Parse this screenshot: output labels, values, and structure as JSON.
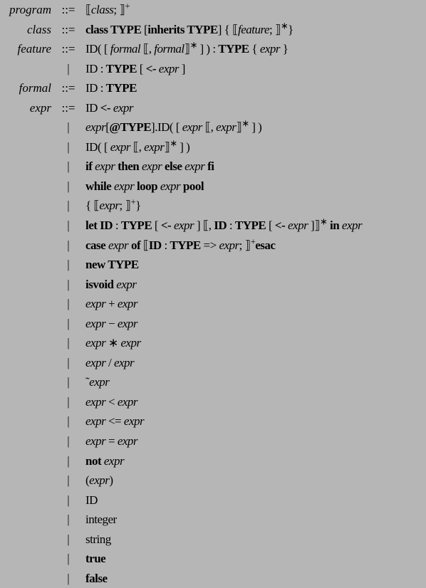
{
  "rows": [
    {
      "lhs": "program",
      "op": "::=",
      "rhs": [
        {
          "t": "⟦",
          "c": ""
        },
        {
          "t": "class",
          "c": "it"
        },
        {
          "t": "; ⟧",
          "c": ""
        },
        {
          "t": "+",
          "c": "sup"
        }
      ]
    },
    {
      "lhs": "class",
      "op": "::=",
      "rhs": [
        {
          "t": "class TYPE ",
          "c": "bf"
        },
        {
          "t": "[",
          "c": ""
        },
        {
          "t": "inherits TYPE",
          "c": "bf"
        },
        {
          "t": "]",
          "c": ""
        },
        {
          "t": " { ⟦",
          "c": ""
        },
        {
          "t": "feature",
          "c": "it"
        },
        {
          "t": "; ⟧",
          "c": ""
        },
        {
          "t": "∗",
          "c": "sup"
        },
        {
          "t": "}",
          "c": ""
        }
      ]
    },
    {
      "lhs": "feature",
      "op": "::=",
      "rhs": [
        {
          "t": "ID",
          "c": ""
        },
        {
          "t": "( [ ",
          "c": ""
        },
        {
          "t": "formal",
          "c": "it"
        },
        {
          "t": " ⟦, ",
          "c": ""
        },
        {
          "t": "formal",
          "c": "it"
        },
        {
          "t": "⟧",
          "c": ""
        },
        {
          "t": "∗",
          "c": "sup"
        },
        {
          "t": " ] ) : ",
          "c": ""
        },
        {
          "t": "TYPE",
          "c": "bf"
        },
        {
          "t": " { ",
          "c": ""
        },
        {
          "t": "expr",
          "c": "it"
        },
        {
          "t": " }",
          "c": ""
        }
      ]
    },
    {
      "lhs": "",
      "op": "|",
      "rhs": [
        {
          "t": "ID : ",
          "c": ""
        },
        {
          "t": "TYPE",
          "c": "bf"
        },
        {
          "t": " [ ",
          "c": ""
        },
        {
          "t": "<- ",
          "c": "bf"
        },
        {
          "t": "expr",
          "c": "it"
        },
        {
          "t": " ]",
          "c": ""
        }
      ]
    },
    {
      "lhs": "formal",
      "op": "::=",
      "rhs": [
        {
          "t": "ID : ",
          "c": ""
        },
        {
          "t": "TYPE",
          "c": "bf"
        }
      ]
    },
    {
      "lhs": "expr",
      "op": "::=",
      "rhs": [
        {
          "t": "ID ",
          "c": ""
        },
        {
          "t": "<- ",
          "c": "bf"
        },
        {
          "t": "expr",
          "c": "it"
        }
      ]
    },
    {
      "lhs": "",
      "op": "|",
      "rhs": [
        {
          "t": "expr",
          "c": "it"
        },
        {
          "t": "[",
          "c": ""
        },
        {
          "t": "@TYPE",
          "c": "bf"
        },
        {
          "t": "].ID( [ ",
          "c": ""
        },
        {
          "t": "expr",
          "c": "it"
        },
        {
          "t": " ⟦, ",
          "c": ""
        },
        {
          "t": "expr",
          "c": "it"
        },
        {
          "t": "⟧",
          "c": ""
        },
        {
          "t": "∗",
          "c": "sup"
        },
        {
          "t": " ] )",
          "c": ""
        }
      ]
    },
    {
      "lhs": "",
      "op": "|",
      "rhs": [
        {
          "t": "ID( [ ",
          "c": ""
        },
        {
          "t": "expr",
          "c": "it"
        },
        {
          "t": " ⟦, ",
          "c": ""
        },
        {
          "t": "expr",
          "c": "it"
        },
        {
          "t": "⟧",
          "c": ""
        },
        {
          "t": "∗",
          "c": "sup"
        },
        {
          "t": " ] )",
          "c": ""
        }
      ]
    },
    {
      "lhs": "",
      "op": "|",
      "rhs": [
        {
          "t": "if ",
          "c": "bf"
        },
        {
          "t": "expr",
          "c": "it"
        },
        {
          "t": " then ",
          "c": "bf"
        },
        {
          "t": "expr",
          "c": "it"
        },
        {
          "t": " else ",
          "c": "bf"
        },
        {
          "t": "expr",
          "c": "it"
        },
        {
          "t": " fi",
          "c": "bf"
        }
      ]
    },
    {
      "lhs": "",
      "op": "|",
      "rhs": [
        {
          "t": "while ",
          "c": "bf"
        },
        {
          "t": "expr",
          "c": "it"
        },
        {
          "t": " loop ",
          "c": "bf"
        },
        {
          "t": "expr",
          "c": "it"
        },
        {
          "t": " pool",
          "c": "bf"
        }
      ]
    },
    {
      "lhs": "",
      "op": "|",
      "rhs": [
        {
          "t": "{ ⟦",
          "c": ""
        },
        {
          "t": "expr",
          "c": "it"
        },
        {
          "t": "; ⟧",
          "c": ""
        },
        {
          "t": "+",
          "c": "sup"
        },
        {
          "t": "}",
          "c": ""
        }
      ]
    },
    {
      "lhs": "",
      "op": "|",
      "rhs": [
        {
          "t": "let ID ",
          "c": "bf"
        },
        {
          "t": ": ",
          "c": ""
        },
        {
          "t": "TYPE",
          "c": "bf"
        },
        {
          "t": " [ ",
          "c": ""
        },
        {
          "t": "<- ",
          "c": "bf"
        },
        {
          "t": "expr",
          "c": "it"
        },
        {
          "t": " ] ⟦, ",
          "c": ""
        },
        {
          "t": "ID ",
          "c": "bf"
        },
        {
          "t": ": ",
          "c": ""
        },
        {
          "t": "TYPE",
          "c": "bf"
        },
        {
          "t": " [ ",
          "c": ""
        },
        {
          "t": "<- ",
          "c": "bf"
        },
        {
          "t": "expr",
          "c": "it"
        },
        {
          "t": " ]⟧",
          "c": ""
        },
        {
          "t": "∗",
          "c": "sup"
        },
        {
          "t": " in ",
          "c": "bf"
        },
        {
          "t": "expr",
          "c": "it"
        }
      ]
    },
    {
      "lhs": "",
      "op": "|",
      "rhs": [
        {
          "t": "case ",
          "c": "bf"
        },
        {
          "t": "expr",
          "c": "it"
        },
        {
          "t": " of ",
          "c": "bf"
        },
        {
          "t": "⟦",
          "c": ""
        },
        {
          "t": "ID ",
          "c": "bf"
        },
        {
          "t": ": ",
          "c": ""
        },
        {
          "t": "TYPE ",
          "c": "bf"
        },
        {
          "t": "=> ",
          "c": ""
        },
        {
          "t": "expr",
          "c": "it"
        },
        {
          "t": "; ⟧",
          "c": ""
        },
        {
          "t": "+",
          "c": "sup"
        },
        {
          "t": "esac",
          "c": "bf"
        }
      ]
    },
    {
      "lhs": "",
      "op": "|",
      "rhs": [
        {
          "t": "new TYPE",
          "c": "bf"
        }
      ]
    },
    {
      "lhs": "",
      "op": "|",
      "rhs": [
        {
          "t": "isvoid ",
          "c": "bf"
        },
        {
          "t": "expr",
          "c": "it"
        }
      ]
    },
    {
      "lhs": "",
      "op": "|",
      "rhs": [
        {
          "t": "expr",
          "c": "it"
        },
        {
          "t": " + ",
          "c": ""
        },
        {
          "t": "expr",
          "c": "it"
        }
      ]
    },
    {
      "lhs": "",
      "op": "|",
      "rhs": [
        {
          "t": "expr",
          "c": "it"
        },
        {
          "t": " − ",
          "c": ""
        },
        {
          "t": "expr",
          "c": "it"
        }
      ]
    },
    {
      "lhs": "",
      "op": "|",
      "rhs": [
        {
          "t": "expr",
          "c": "it"
        },
        {
          "t": " ∗ ",
          "c": ""
        },
        {
          "t": "expr",
          "c": "it"
        }
      ]
    },
    {
      "lhs": "",
      "op": "|",
      "rhs": [
        {
          "t": "expr",
          "c": "it"
        },
        {
          "t": " / ",
          "c": ""
        },
        {
          "t": "expr",
          "c": "it"
        }
      ]
    },
    {
      "lhs": "",
      "op": "|",
      "rhs": [
        {
          "t": "˜",
          "c": ""
        },
        {
          "t": "expr",
          "c": "it"
        }
      ]
    },
    {
      "lhs": "",
      "op": "|",
      "rhs": [
        {
          "t": "expr",
          "c": "it"
        },
        {
          "t": " < ",
          "c": ""
        },
        {
          "t": "expr",
          "c": "it"
        }
      ]
    },
    {
      "lhs": "",
      "op": "|",
      "rhs": [
        {
          "t": "expr",
          "c": "it"
        },
        {
          "t": " <= ",
          "c": ""
        },
        {
          "t": "expr",
          "c": "it"
        }
      ]
    },
    {
      "lhs": "",
      "op": "|",
      "rhs": [
        {
          "t": "expr",
          "c": "it"
        },
        {
          "t": " = ",
          "c": ""
        },
        {
          "t": "expr",
          "c": "it"
        }
      ]
    },
    {
      "lhs": "",
      "op": "|",
      "rhs": [
        {
          "t": "not ",
          "c": "bf"
        },
        {
          "t": "expr",
          "c": "it"
        }
      ]
    },
    {
      "lhs": "",
      "op": "|",
      "rhs": [
        {
          "t": "(",
          "c": ""
        },
        {
          "t": "expr",
          "c": "it"
        },
        {
          "t": ")",
          "c": ""
        }
      ]
    },
    {
      "lhs": "",
      "op": "|",
      "rhs": [
        {
          "t": "ID",
          "c": ""
        }
      ]
    },
    {
      "lhs": "",
      "op": "|",
      "rhs": [
        {
          "t": "integer",
          "c": ""
        }
      ]
    },
    {
      "lhs": "",
      "op": "|",
      "rhs": [
        {
          "t": "string",
          "c": ""
        }
      ]
    },
    {
      "lhs": "",
      "op": "|",
      "rhs": [
        {
          "t": "true",
          "c": "bf"
        }
      ]
    },
    {
      "lhs": "",
      "op": "|",
      "rhs": [
        {
          "t": "false",
          "c": "bf"
        }
      ]
    }
  ]
}
